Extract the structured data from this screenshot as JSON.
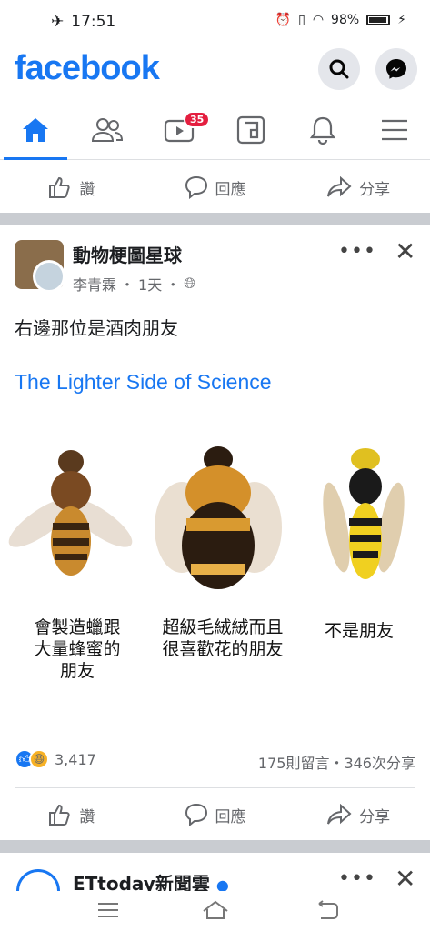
{
  "status": {
    "time": "17:51",
    "battery": "98%"
  },
  "header": {
    "logo": "facebook"
  },
  "nav": {
    "badge_count": "35"
  },
  "actions_top": {
    "like": "讚",
    "comment": "回應",
    "share": "分享"
  },
  "post": {
    "page_name": "動物梗圖星球",
    "author": "李青霖",
    "time": "1天",
    "text": "右邊那位是酒肉朋友",
    "link": "The Lighter Side of Science",
    "captions": [
      "會製造蠟跟\n大量蜂蜜的\n朋友",
      "超級毛絨絨而且\n很喜歡花的朋友",
      "不是朋友"
    ],
    "reaction_count": "3,417",
    "stats": "175則留言・346次分享"
  },
  "actions_bottom": {
    "like": "讚",
    "comment": "回應",
    "share": "分享"
  },
  "next_post": {
    "page_name": "ETtoday新聞雲"
  }
}
